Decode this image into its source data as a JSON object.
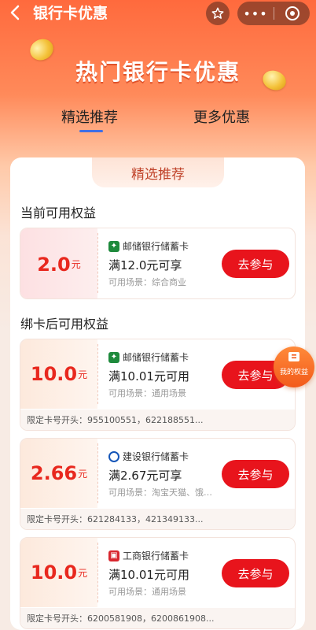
{
  "header": {
    "title": "银行卡优惠",
    "back_icon": "chevron-left-icon",
    "favorite_icon": "star-icon",
    "more_icon": "more-dots-icon",
    "close_icon": "target-icon"
  },
  "banner": {
    "title": "热门银行卡优惠"
  },
  "tabs": [
    {
      "label": "精选推荐",
      "active": true
    },
    {
      "label": "更多优惠",
      "active": false
    }
  ],
  "panel": {
    "chip_label": "精选推荐"
  },
  "sections": {
    "current": {
      "title": "当前可用权益"
    },
    "after_bind": {
      "title": "绑卡后可用权益"
    }
  },
  "cards": [
    {
      "amount": "2.0",
      "unit": "元",
      "bank": "邮储银行储蓄卡",
      "condition": "满12.0元可享",
      "scene": "可用场景：综合商业",
      "button": "去参与"
    },
    {
      "amount": "10.0",
      "unit": "元",
      "bank": "邮储银行储蓄卡",
      "condition": "满10.01元可用",
      "scene": "可用场景：通用场景",
      "button": "去参与",
      "limit": "限定卡号开头：955100551，622188551..."
    },
    {
      "amount": "2.66",
      "unit": "元",
      "bank": "建设银行储蓄卡",
      "condition": "满2.67元可享",
      "scene": "可用场景：淘宝天猫、饿…",
      "button": "去参与",
      "limit": "限定卡号开头：621284133，421349133..."
    },
    {
      "amount": "10.0",
      "unit": "元",
      "bank": "工商银行储蓄卡",
      "condition": "满10.01元可用",
      "scene": "可用场景：通用场景",
      "button": "去参与",
      "limit": "限定卡号开头：6200581908，6200861908..."
    }
  ],
  "float_button": {
    "label": "我的权益"
  },
  "colors": {
    "accent": "#e8141c",
    "brand": "#ff6a3d",
    "tab_indicator": "#3f6fe5"
  }
}
